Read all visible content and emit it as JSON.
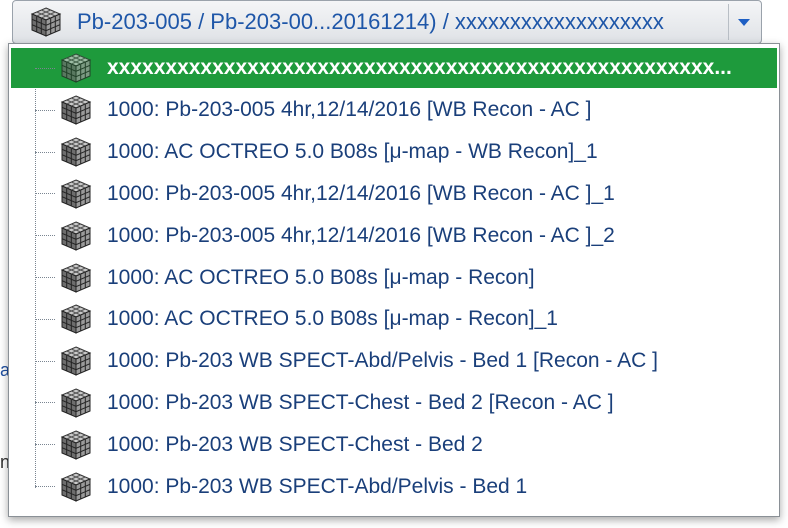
{
  "combo": {
    "title": "Pb-203-005 / Pb-203-00...20161214) / xxxxxxxxxxxxxxxxxxx",
    "icon": "volume-cube-icon"
  },
  "background_glyphs": [
    "a",
    "n"
  ],
  "series": [
    {
      "label": "xxxxxxxxxxxxxxxxxxxxxxxxxxxxxxxxxxxxxxxxxxxxxxxxxxxx...",
      "selected": true
    },
    {
      "label": "1000: Pb-203-005 4hr,12/14/2016 [WB Recon - AC ]"
    },
    {
      "label": "1000: AC OCTREO  5.0  B08s [μ-map - WB Recon]_1"
    },
    {
      "label": "1000: Pb-203-005 4hr,12/14/2016 [WB Recon - AC ]_1"
    },
    {
      "label": "1000: Pb-203-005 4hr,12/14/2016 [WB Recon - AC ]_2"
    },
    {
      "label": "1000: AC OCTREO  5.0  B08s [μ-map - Recon]"
    },
    {
      "label": "1000: AC OCTREO  5.0  B08s [μ-map - Recon]_1"
    },
    {
      "label": "1000: Pb-203 WB SPECT-Abd/Pelvis - Bed 1 [Recon - AC ]"
    },
    {
      "label": "1000: Pb-203 WB SPECT-Chest - Bed 2 [Recon - AC ]"
    },
    {
      "label": "1000: Pb-203 WB SPECT-Chest - Bed 2"
    },
    {
      "label": "1000: Pb-203 WB SPECT-Abd/Pelvis - Bed 1"
    }
  ],
  "colors": {
    "selection": "#1e9a3c",
    "text": "#1a3f7a",
    "title": "#1e56a8"
  }
}
